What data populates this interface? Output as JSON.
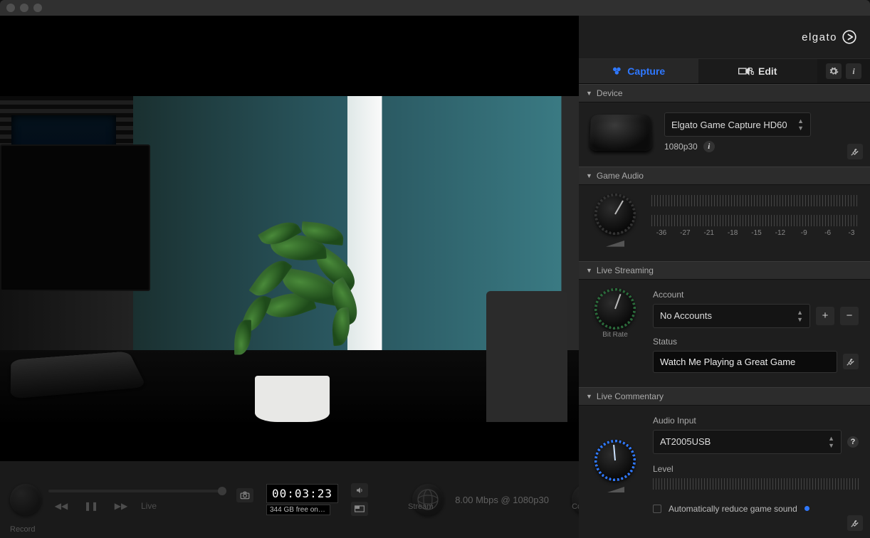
{
  "brand": "elgato",
  "tabs": {
    "capture": "Capture",
    "edit": "Edit"
  },
  "sections": {
    "device": "Device",
    "game_audio": "Game Audio",
    "live_streaming": "Live Streaming",
    "live_commentary": "Live Commentary"
  },
  "device": {
    "name": "Elgato Game Capture HD60",
    "mode": "1080p30"
  },
  "game_audio": {
    "db_labels": [
      "-36",
      "-27",
      "-21",
      "-18",
      "-15",
      "-12",
      "-9",
      "-6",
      "-3"
    ]
  },
  "streaming": {
    "account_label": "Account",
    "account_value": "No Accounts",
    "status_label": "Status",
    "status_value": "Watch Me Playing a Great Game",
    "bitrate_label": "Bit Rate"
  },
  "commentary": {
    "input_label": "Audio Input",
    "input_value": "AT2005USB",
    "level_label": "Level",
    "auto_reduce": "Automatically reduce game sound"
  },
  "bottom": {
    "record": "Record",
    "live": "Live",
    "stream": "Stream",
    "commentary": "Commentary",
    "timecode": "00:03:23",
    "free": "344 GB free on…",
    "quality": "8.00 Mbps @ 1080p30"
  }
}
